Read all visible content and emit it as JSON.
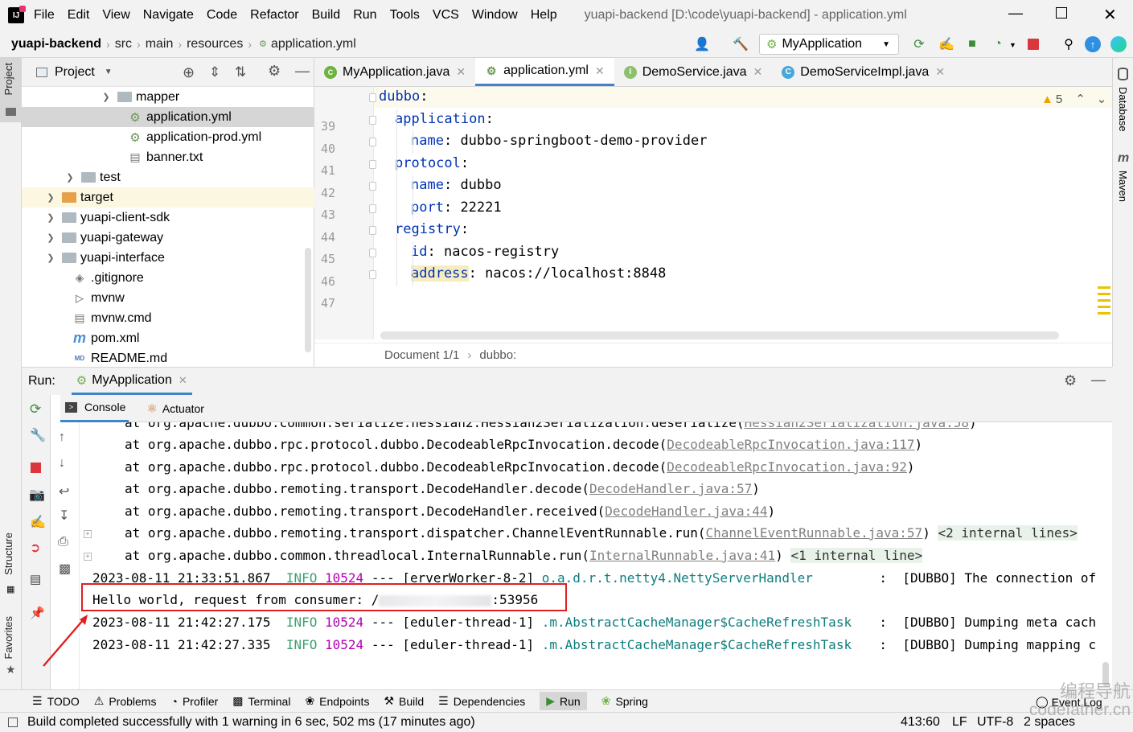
{
  "menubar": {
    "items": [
      "File",
      "Edit",
      "View",
      "Navigate",
      "Code",
      "Refactor",
      "Build",
      "Run",
      "Tools",
      "VCS",
      "Window",
      "Help"
    ],
    "window_title": "yuapi-backend [D:\\code\\yuapi-backend] - application.yml"
  },
  "navbar": {
    "breadcrumbs": [
      "yuapi-backend",
      "src",
      "main",
      "resources",
      "application.yml"
    ],
    "run_config": "MyApplication"
  },
  "left_strip": {
    "project": "Project",
    "structure": "Structure",
    "favorites": "Favorites"
  },
  "right_strip": {
    "database": "Database",
    "maven": "Maven"
  },
  "project_panel": {
    "title": "Project",
    "tree": [
      {
        "label": "mapper",
        "kind": "folder",
        "expanded": false
      },
      {
        "label": "application.yml",
        "kind": "yml"
      },
      {
        "label": "application-prod.yml",
        "kind": "yml"
      },
      {
        "label": "banner.txt",
        "kind": "txt"
      },
      {
        "label": "test",
        "kind": "folder",
        "expanded": false
      },
      {
        "label": "target",
        "kind": "folder-orange",
        "expanded": false
      },
      {
        "label": "yuapi-client-sdk",
        "kind": "folder",
        "expanded": false
      },
      {
        "label": "yuapi-gateway",
        "kind": "folder",
        "expanded": false
      },
      {
        "label": "yuapi-interface",
        "kind": "folder",
        "expanded": false
      },
      {
        "label": ".gitignore",
        "kind": "gitignore"
      },
      {
        "label": "mvnw",
        "kind": "script"
      },
      {
        "label": "mvnw.cmd",
        "kind": "cmd"
      },
      {
        "label": "pom.xml",
        "kind": "maven"
      },
      {
        "label": "README.md",
        "kind": "md"
      }
    ]
  },
  "editor": {
    "tabs": [
      {
        "label": "MyApplication.java",
        "icon": "class"
      },
      {
        "label": "application.yml",
        "icon": "yml",
        "active": true
      },
      {
        "label": "DemoService.java",
        "icon": "interface"
      },
      {
        "label": "DemoServiceImpl.java",
        "icon": "class"
      }
    ],
    "warnings": "5",
    "lines": [
      {
        "num": "39",
        "indent": 0,
        "key": "dubbo",
        "value": ""
      },
      {
        "num": "40",
        "indent": 1,
        "key": "application",
        "value": ""
      },
      {
        "num": "41",
        "indent": 2,
        "key": "name",
        "value": " dubbo-springboot-demo-provider"
      },
      {
        "num": "42",
        "indent": 1,
        "key": "protocol",
        "value": ""
      },
      {
        "num": "43",
        "indent": 2,
        "key": "name",
        "value": " dubbo"
      },
      {
        "num": "44",
        "indent": 2,
        "key": "port",
        "value": " 22221"
      },
      {
        "num": "45",
        "indent": 1,
        "key": "registry",
        "value": ""
      },
      {
        "num": "46",
        "indent": 2,
        "key": "id",
        "value": " nacos-registry"
      },
      {
        "num": "47",
        "indent": 2,
        "key": "address",
        "value": " nacos://localhost:8848"
      }
    ],
    "breadcrumb": [
      "Document 1/1",
      "dubbo:"
    ]
  },
  "run_panel": {
    "label": "Run:",
    "tab": "MyApplication",
    "subtabs": [
      "Console",
      "Actuator"
    ],
    "console": [
      {
        "prefix": "at org.apache.dubbo.common.serialize.hessian2.Hessian2Serialization.deserialize(",
        "link": "Hessian2Serialization.java:58",
        "suffix": ")",
        "partial": true
      },
      {
        "prefix": "at org.apache.dubbo.rpc.protocol.dubbo.DecodeableRpcInvocation.decode(",
        "link": "DecodeableRpcInvocation.java:117",
        "suffix": ")"
      },
      {
        "prefix": "at org.apache.dubbo.rpc.protocol.dubbo.DecodeableRpcInvocation.decode(",
        "link": "DecodeableRpcInvocation.java:92",
        "suffix": ")"
      },
      {
        "prefix": "at org.apache.dubbo.remoting.transport.DecodeHandler.decode(",
        "link": "DecodeHandler.java:57",
        "suffix": ")"
      },
      {
        "prefix": "at org.apache.dubbo.remoting.transport.DecodeHandler.received(",
        "link": "DecodeHandler.java:44",
        "suffix": ")"
      },
      {
        "prefix": "at org.apache.dubbo.remoting.transport.dispatcher.ChannelEventRunnable.run(",
        "link": "ChannelEventRunnable.java:57",
        "suffix": ")",
        "fold": "<2 internal lines>"
      },
      {
        "prefix": "at org.apache.dubbo.common.threadlocal.InternalRunnable.run(",
        "link": "InternalRunnable.java:41",
        "suffix": ")",
        "fold": "<1 internal line>"
      }
    ],
    "log_lines": [
      {
        "ts": "2023-08-11 21:33:51.867",
        "level": "INFO",
        "pid": "10524",
        "sep": "---",
        "thread": "[erverWorker-8-2]",
        "logger": "o.a.d.r.t.netty4.NettyServerHandler",
        "colon": ":",
        "msg": "[DUBBO] The connection of"
      },
      {
        "ts": "2023-08-11 21:42:27.175",
        "level": "INFO",
        "pid": "10524",
        "sep": "---",
        "thread": "[eduler-thread-1]",
        "logger": ".m.AbstractCacheManager$CacheRefreshTask",
        "colon": ":",
        "msg": "[DUBBO] Dumping meta cach"
      },
      {
        "ts": "2023-08-11 21:42:27.335",
        "level": "INFO",
        "pid": "10524",
        "sep": "---",
        "thread": "[eduler-thread-1]",
        "logger": ".m.AbstractCacheManager$CacheRefreshTask",
        "colon": ":",
        "msg": "[DUBBO] Dumping mapping c"
      }
    ],
    "hello_line": "Hello world, request from consumer: /",
    "hello_port": ":53956"
  },
  "bottom_tools": [
    "TODO",
    "Problems",
    "Profiler",
    "Terminal",
    "Endpoints",
    "Build",
    "Dependencies",
    "Run",
    "Spring"
  ],
  "event_log": "Event Log",
  "status": {
    "message": "Build completed successfully with 1 warning in 6 sec, 502 ms (17 minutes ago)",
    "position": "413:60",
    "line_sep": "LF",
    "encoding": "UTF-8",
    "indent": "2 spaces"
  },
  "watermark": {
    "cn": "编程导航",
    "en": "codefather.cn"
  },
  "colors": {
    "accent": "#4083c9",
    "annotation": "#e02020",
    "keyword": "#0033b3",
    "info": "#40a070",
    "pid": "#b200b2",
    "logger": "#0e7d7d"
  }
}
